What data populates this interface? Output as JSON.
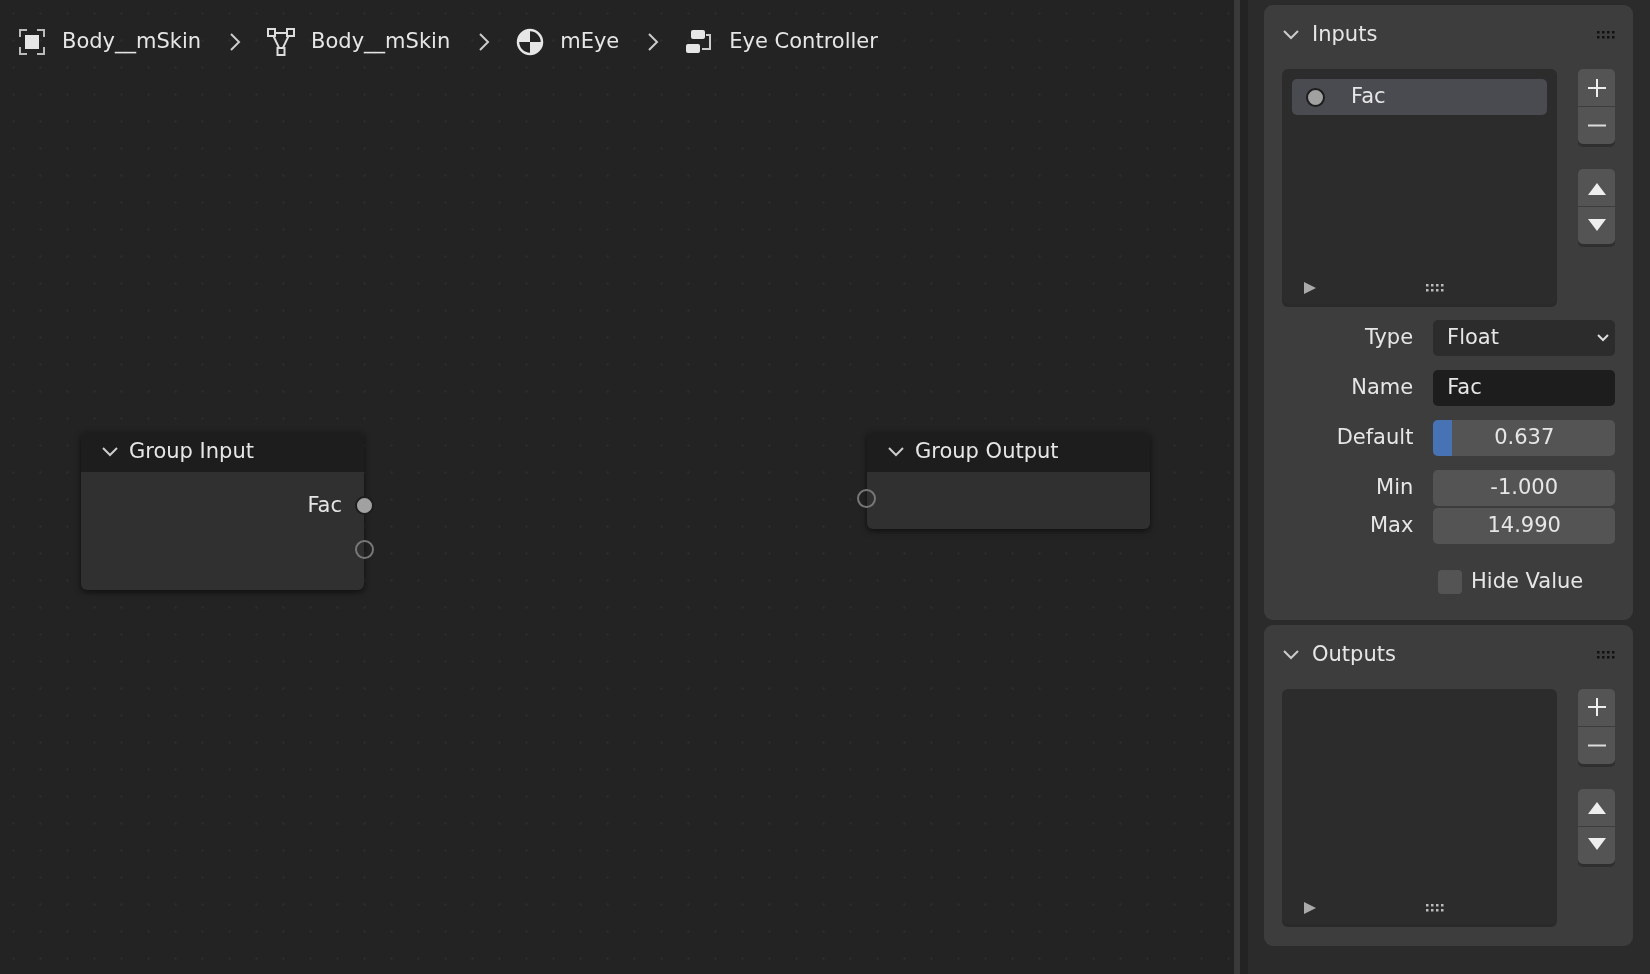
{
  "breadcrumbs": [
    {
      "kind": "object",
      "label": "Body__mSkin"
    },
    {
      "kind": "mesh",
      "label": "Body__mSkin"
    },
    {
      "kind": "material",
      "label": "mEye"
    },
    {
      "kind": "nodegroup",
      "label": "Eye Controller"
    }
  ],
  "nodes": [
    {
      "kind": "input",
      "title": "Group Input",
      "expanded": true,
      "sockets": [
        {
          "kind": "float",
          "label": "Fac"
        },
        {
          "kind": "virtual"
        }
      ]
    },
    {
      "kind": "output",
      "title": "Group Output",
      "expanded": true,
      "sockets": [
        {
          "kind": "virtual"
        }
      ]
    }
  ],
  "panels": [
    {
      "title": "Inputs",
      "expanded": true,
      "items": [
        {
          "label": "Fac",
          "selected": true
        }
      ],
      "fields": [
        {
          "kind": "dropdown",
          "label": "Type",
          "value": "Float"
        },
        {
          "kind": "text",
          "label": "Name",
          "value": "Fac"
        },
        {
          "kind": "slider",
          "label": "Default",
          "value": "0.637",
          "level": 0.1
        },
        {
          "kind": "number",
          "label": "Min",
          "value": "-1.000"
        },
        {
          "kind": "number",
          "label": "Max",
          "value": "14.990"
        },
        {
          "kind": "checkbox",
          "label": "Hide Value",
          "checked": false
        }
      ]
    },
    {
      "title": "Outputs",
      "expanded": true
    }
  ]
}
